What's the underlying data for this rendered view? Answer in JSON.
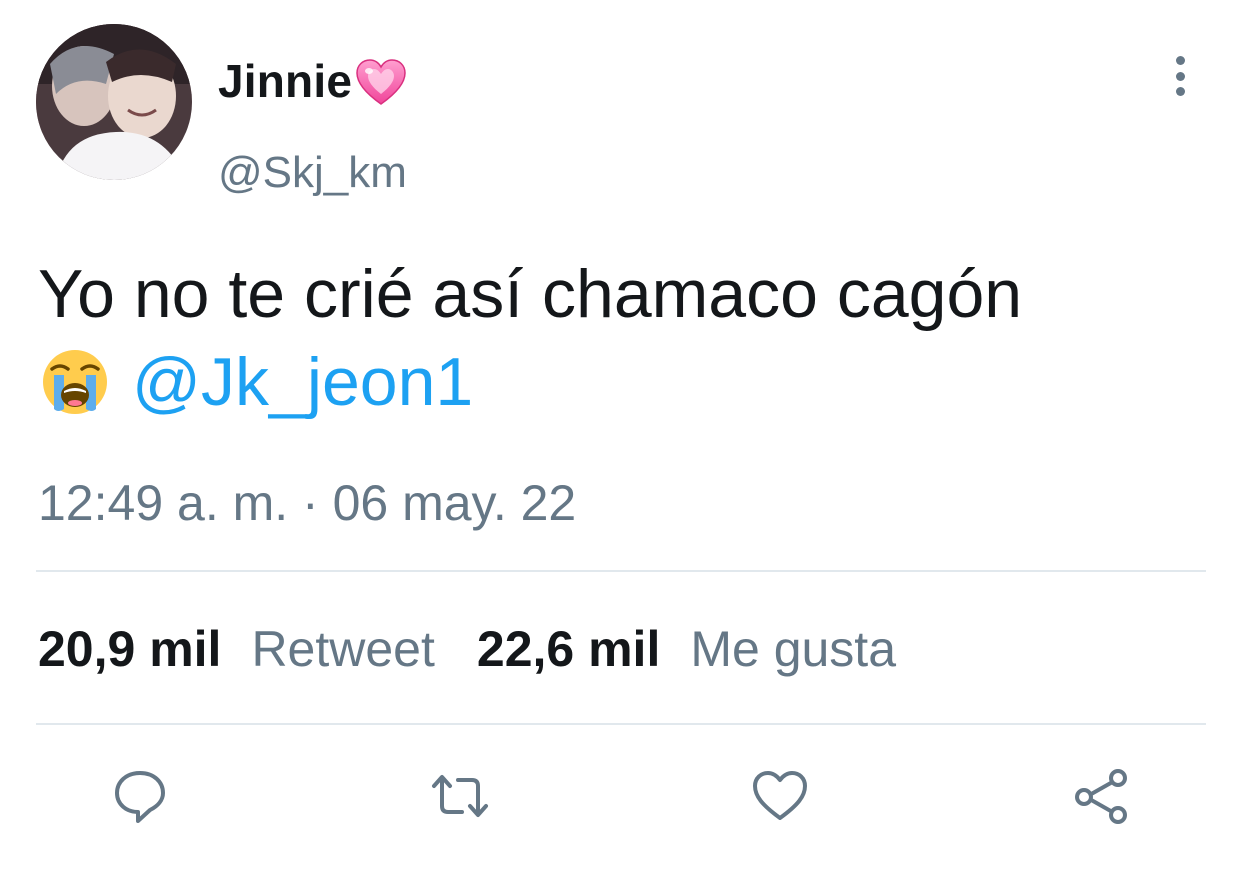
{
  "author": {
    "display_name": "Jinnie",
    "handle": "@Skj_km",
    "name_emoji": "sparkling-heart-icon"
  },
  "tweet": {
    "text_line1": "Yo no te crié así chamaco cagón",
    "emoji": "loudly-crying-face-icon",
    "mention": "@Jk_jeon1"
  },
  "timestamp": "12:49 a. m. · 06 may. 22",
  "stats": {
    "retweets_count": "20,9 mil",
    "retweets_label": "Retweet",
    "likes_count": "22,6 mil",
    "likes_label": "Me gusta"
  },
  "actions": {
    "reply_icon": "speech-bubble-icon",
    "retweet_icon": "retweet-arrows-icon",
    "like_icon": "heart-outline-icon",
    "share_icon": "share-nodes-icon"
  },
  "colors": {
    "text": "#14171a",
    "secondary": "#657786",
    "link": "#1da1f2",
    "divider": "#e1e8ed"
  }
}
